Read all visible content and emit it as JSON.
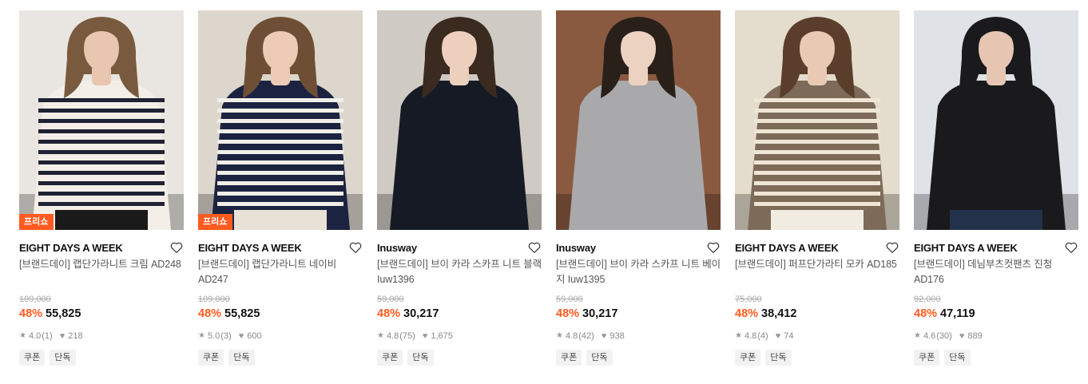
{
  "products": [
    {
      "badge": "프리쇼",
      "brand": "EIGHT DAYS A WEEK",
      "title": "[브랜드데이] 랩단가라니트 크림 AD248",
      "original_price": "109,000",
      "discount": "48%",
      "price": "55,825",
      "rating": "4.0",
      "reviews": "(1)",
      "likes": "218",
      "tags": [
        "쿠폰",
        "단독"
      ],
      "colors": {
        "bg": "#e9e6e1",
        "top": "#f3efe8",
        "stripe": "#1e2233",
        "hair": "#7a5a3e",
        "skin": "#e8c6b0",
        "bottom": "#1a1a1a"
      }
    },
    {
      "badge": "프리쇼",
      "brand": "EIGHT DAYS A WEEK",
      "title": "[브랜드데이] 랩단가라니트 네이비 AD247",
      "original_price": "109,000",
      "discount": "48%",
      "price": "55,825",
      "rating": "5.0",
      "reviews": "(3)",
      "likes": "600",
      "tags": [
        "쿠폰",
        "단독"
      ],
      "colors": {
        "bg": "#dcd6cc",
        "top": "#1b2340",
        "stripe": "#f1efe9",
        "hair": "#6e4f36",
        "skin": "#eccab5",
        "bottom": "#e8e2d6"
      }
    },
    {
      "badge": "",
      "brand": "Inusway",
      "title": "[브랜드데이] 브이 카라 스카프 니트 블랙 Iuw1396",
      "original_price": "59,000",
      "discount": "48%",
      "price": "30,217",
      "rating": "4.8",
      "reviews": "(75)",
      "likes": "1,675",
      "tags": [
        "쿠폰",
        "단독"
      ],
      "colors": {
        "bg": "#cfcac4",
        "top": "#161a24",
        "stripe": "#161a24",
        "hair": "#3a2a20",
        "skin": "#ecd0bd",
        "bottom": "#161a24"
      }
    },
    {
      "badge": "",
      "brand": "Inusway",
      "title": "[브랜드데이] 브이 카라 스카프 니트 베이지 Iuw1395",
      "original_price": "59,000",
      "discount": "48%",
      "price": "30,217",
      "rating": "4.8",
      "reviews": "(42)",
      "likes": "938",
      "tags": [
        "쿠폰",
        "단독"
      ],
      "colors": {
        "bg": "#8a5a40",
        "top": "#a9a9ab",
        "stripe": "#a9a9ab",
        "hair": "#2a201a",
        "skin": "#ecd2c0",
        "bottom": "#a9a9ab"
      }
    },
    {
      "badge": "",
      "brand": "EIGHT DAYS A WEEK",
      "title": "[브랜드데이] 퍼프단가라티 모카 AD185",
      "original_price": "75,000",
      "discount": "48%",
      "price": "38,412",
      "rating": "4.8",
      "reviews": "(4)",
      "likes": "74",
      "tags": [
        "쿠폰",
        "단독"
      ],
      "colors": {
        "bg": "#e4dccd",
        "top": "#7d6a58",
        "stripe": "#efe6d6",
        "hair": "#5a3e2b",
        "skin": "#e9c9b4",
        "bottom": "#f1ece2"
      }
    },
    {
      "badge": "",
      "brand": "EIGHT DAYS A WEEK",
      "title": "[브랜드데이] 데님부츠컷팬츠 진청 AD176",
      "original_price": "92,000",
      "discount": "48%",
      "price": "47,119",
      "rating": "4.6",
      "reviews": "(30)",
      "likes": "889",
      "tags": [
        "쿠폰",
        "단독"
      ],
      "colors": {
        "bg": "#dfe2e6",
        "top": "#1a1a1c",
        "stripe": "#1a1a1c",
        "hair": "#1a1a1c",
        "skin": "#e6c6b2",
        "bottom": "#23324a"
      }
    }
  ]
}
